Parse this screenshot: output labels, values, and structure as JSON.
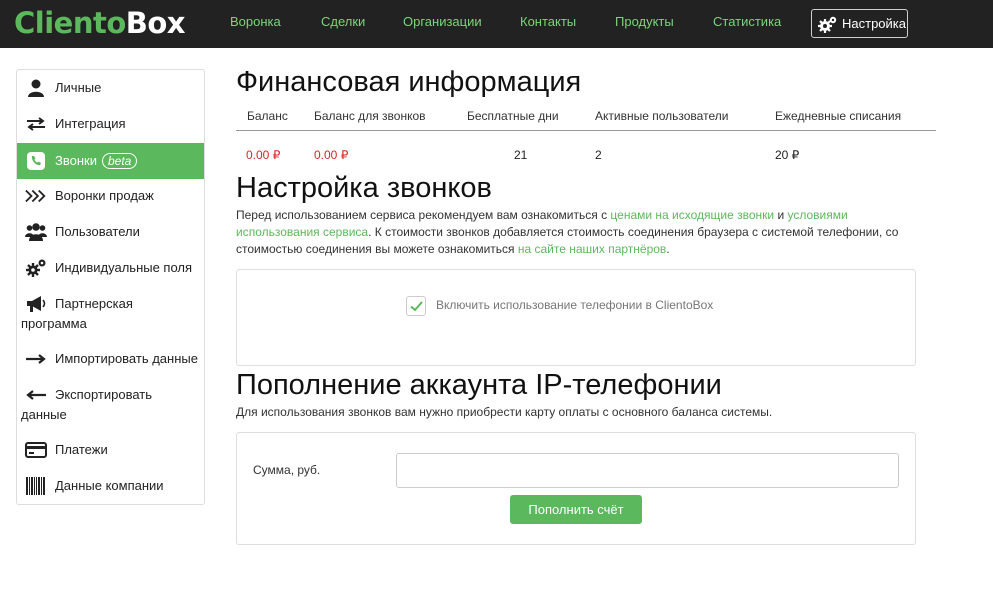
{
  "app": {
    "logo_part1": "Cliento",
    "logo_part2": "Box"
  },
  "nav": {
    "items": [
      "Воронка",
      "Сделки",
      "Организации",
      "Контакты",
      "Продукты",
      "Статистика"
    ],
    "settings_label": "Настройка"
  },
  "sidebar": {
    "items": [
      {
        "label": "Личные",
        "icon": "user-icon"
      },
      {
        "label": "Интеграция",
        "icon": "arrows-exchange-icon"
      },
      {
        "label": "Звонки",
        "badge": "beta",
        "icon": "phone-icon",
        "active": true
      },
      {
        "label": "Воронки продаж",
        "icon": "chevrons-right-icon"
      },
      {
        "label": "Пользователи",
        "icon": "users-icon"
      },
      {
        "label": "Индивидуальные поля",
        "icon": "gears-icon"
      },
      {
        "label": "Партнерская",
        "label2": "программа",
        "icon": "megaphone-icon"
      },
      {
        "label": "Импортировать данные",
        "icon": "arrow-right-icon"
      },
      {
        "label": "Экспортировать",
        "label2": "данные",
        "icon": "arrow-left-icon"
      },
      {
        "label": "Платежи",
        "icon": "credit-card-icon"
      },
      {
        "label": "Данные компании",
        "icon": "barcode-icon"
      }
    ]
  },
  "finance": {
    "title": "Финансовая информация",
    "headers": [
      "Баланс",
      "Баланс для звонков",
      "Бесплатные дни",
      "Активные пользователи",
      "Ежедневные списания"
    ],
    "values": [
      "0.00 ₽",
      "0.00 ₽",
      "21",
      "2",
      "20 ₽"
    ]
  },
  "calls": {
    "title": "Настройка звонков",
    "text1": "Перед использованием сервиса рекомендуем вам ознакомиться с ",
    "link1": "ценами на исходящие звонки",
    "text2": " и ",
    "link2a": "условиями",
    "link2b": "использования сервиса",
    "text3": ". К стоимости звонков добавляется стоимость соединения браузера с системой телефонии, со",
    "text4": "стоимостью соединения вы можете ознакомиться ",
    "link3": "на сайте наших партнёров",
    "text5": ".",
    "checkbox_label": "Включить использование телефонии в ClientoBox",
    "checkbox_checked": true
  },
  "topup": {
    "title": "Пополнение аккаунта IP-телефонии",
    "description": "Для использования звонков вам нужно приобрести карту оплаты с основного баланса системы.",
    "amount_label": "Сумма, руб.",
    "amount_value": "",
    "button_label": "Пополнить счёт"
  },
  "colors": {
    "accent": "#5cb85c",
    "negative": "#d9261c",
    "topbar": "#222222"
  }
}
